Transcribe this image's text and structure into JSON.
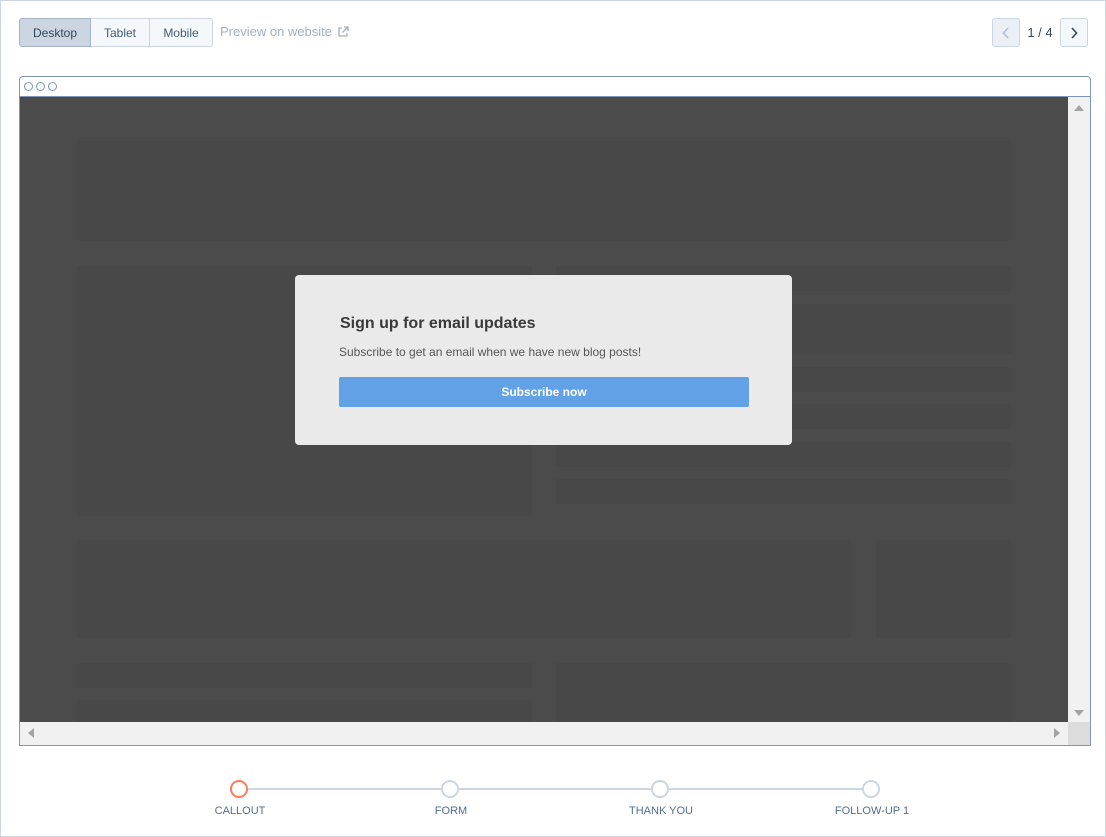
{
  "toolbar": {
    "device_tabs": [
      {
        "label": "Desktop",
        "active": true
      },
      {
        "label": "Tablet",
        "active": false
      },
      {
        "label": "Mobile",
        "active": false
      }
    ],
    "preview_link": "Preview on website",
    "pager": "1 / 4"
  },
  "popup": {
    "title": "Sign up for email updates",
    "body": "Subscribe to get an email when we have new blog posts!",
    "button": "Subscribe now"
  },
  "steps": [
    {
      "label": "CALLOUT",
      "active": true
    },
    {
      "label": "FORM",
      "active": false
    },
    {
      "label": "THANK YOU",
      "active": false
    },
    {
      "label": "FOLLOW-UP 1",
      "active": false
    }
  ],
  "colors": {
    "accent_step": "#ff7a59",
    "popup_button": "#62a1e6",
    "overlay": "#4b4b4b"
  },
  "icons": {
    "external_link": "external-link-icon",
    "prev": "chevron-left-icon",
    "next": "chevron-right-icon"
  }
}
